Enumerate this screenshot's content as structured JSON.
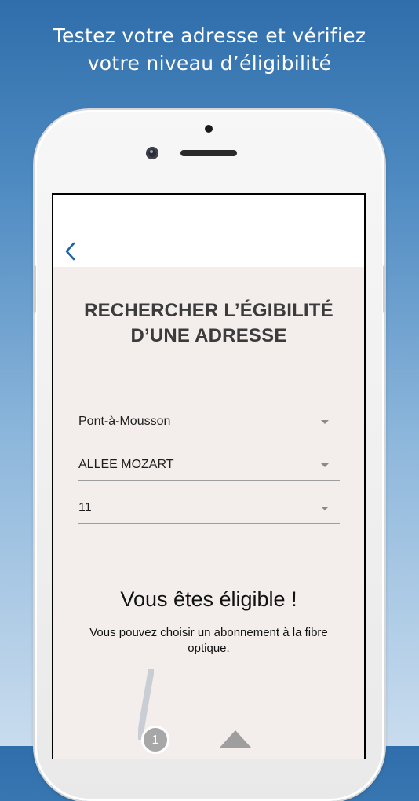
{
  "headline": {
    "line1": "Testez votre adresse et vérifiez",
    "line2": "votre niveau d’éligibilité"
  },
  "screen": {
    "title_line1": "RECHERCHER L’ÉGIBILITÉ",
    "title_line2": "D’UNE ADRESSE",
    "fields": {
      "city": "Pont-à-Mousson",
      "street": "ALLEE MOZART",
      "number": "11"
    },
    "result": {
      "title": "Vous êtes éligible !",
      "subtitle": "Vous pouvez choisir un abonnement à la fibre optique."
    },
    "step_label": "1"
  },
  "colors": {
    "background_top": "#2f6eab",
    "background_bottom": "#c9dcee",
    "screen_bg": "#f3edec",
    "back_chevron": "#1f5fa3"
  },
  "icons": {
    "back": "chevron-left-icon",
    "dropdown": "caret-down-icon"
  }
}
